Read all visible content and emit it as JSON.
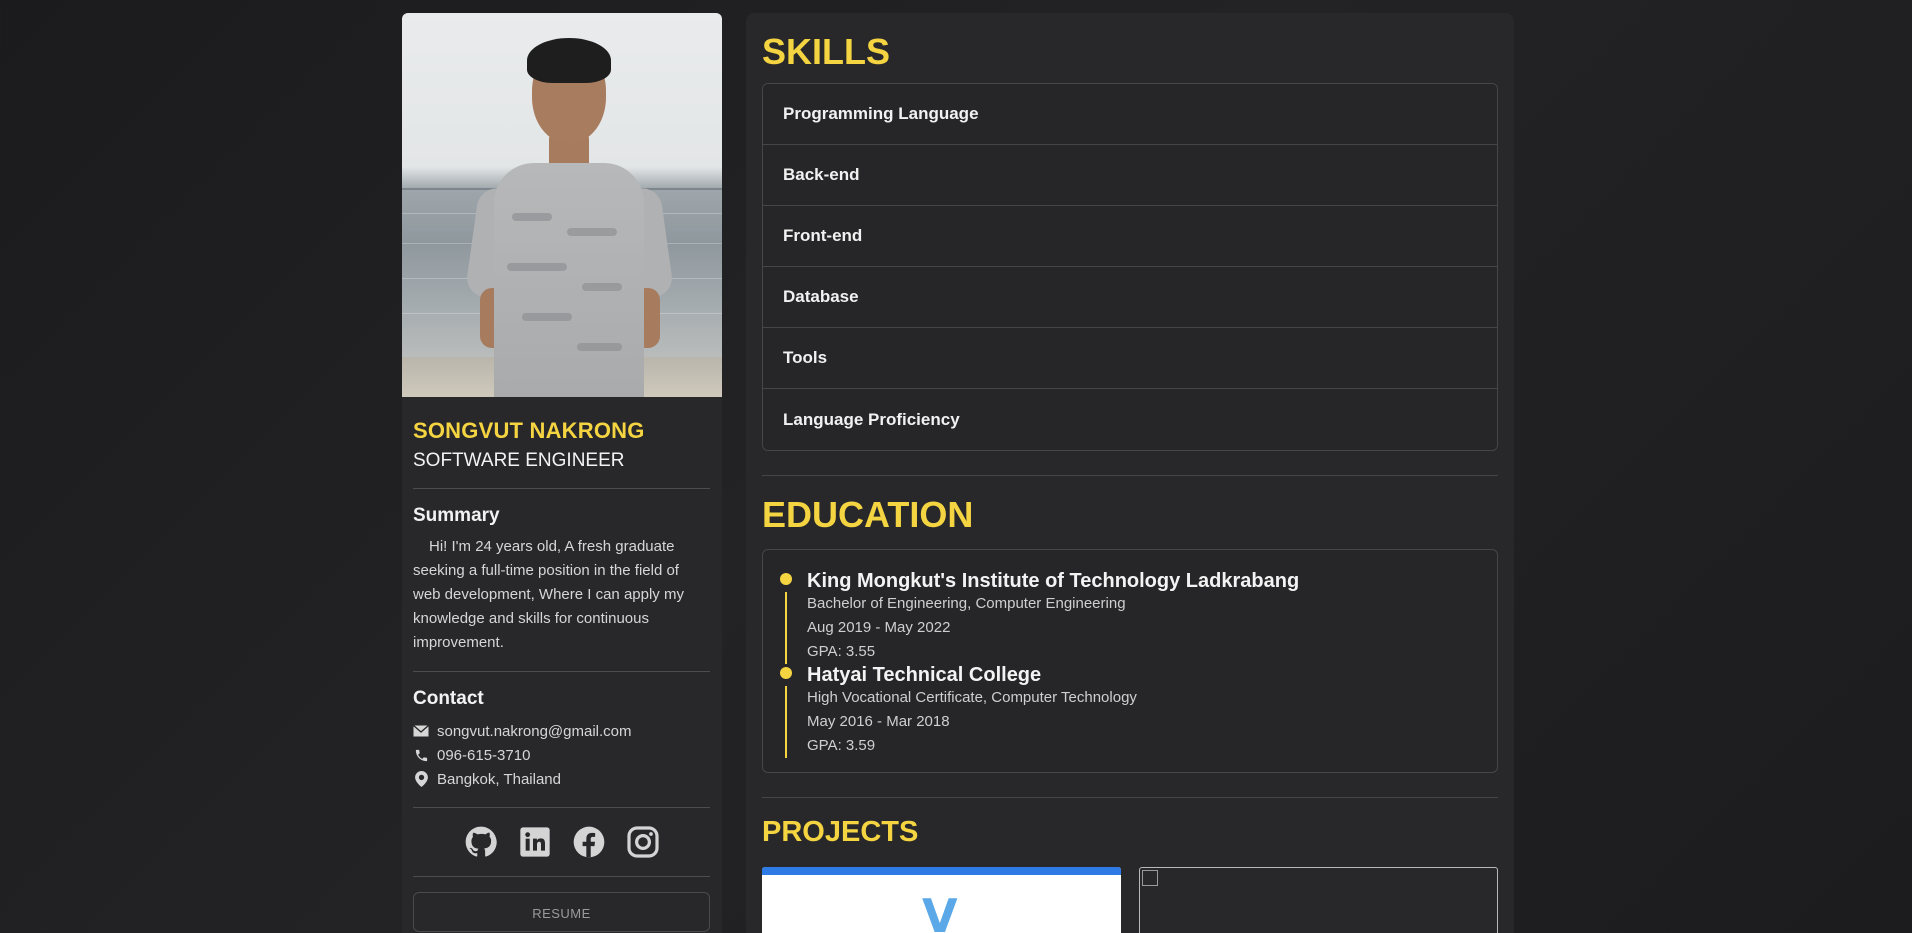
{
  "profile": {
    "name": "SONGVUT NAKRONG",
    "role": "SOFTWARE ENGINEER"
  },
  "summary": {
    "title": "Summary",
    "text": "Hi! I'm 24 years old, A fresh graduate seeking a full-time position in the field of web development, Where I can apply my knowledge and skills for continuous improvement."
  },
  "contact": {
    "title": "Contact",
    "email": "songvut.nakrong@gmail.com",
    "phone": "096-615-3710",
    "location": "Bangkok, Thailand"
  },
  "socials": [
    "github-icon",
    "linkedin-icon",
    "facebook-icon",
    "instagram-icon"
  ],
  "resume_label": "RESUME",
  "skills": {
    "title": "SKILLS",
    "items": [
      "Programming Language",
      "Back-end",
      "Front-end",
      "Database",
      "Tools",
      "Language Proficiency"
    ]
  },
  "education": {
    "title": "EDUCATION",
    "items": [
      {
        "school": "King Mongkut's Institute of Technology Ladkrabang",
        "degree": "Bachelor of Engineering, Computer Engineering",
        "period": "Aug 2019 - May 2022",
        "gpa": "GPA: 3.55"
      },
      {
        "school": "Hatyai Technical College",
        "degree": "High Vocational Certificate, Computer Technology",
        "period": "May 2016 - Mar 2018",
        "gpa": "GPA: 3.59"
      }
    ]
  },
  "projects": {
    "title": "PROJECTS",
    "first_logo_letter": "V"
  },
  "colors": {
    "accent": "#f5d442",
    "panel": "#28282b",
    "background": "#1e1e20"
  }
}
